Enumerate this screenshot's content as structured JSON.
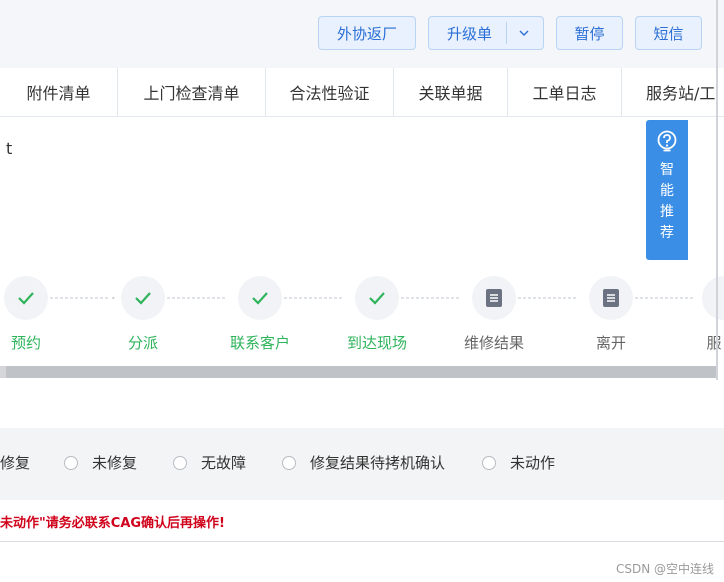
{
  "toolbar": {
    "buttons": [
      "外协返厂",
      "升级单",
      "暂停",
      "短信"
    ]
  },
  "tabs": [
    "附件清单",
    "上门检查清单",
    "合法性验证",
    "关联单据",
    "工单日志",
    "服务站/工"
  ],
  "panel": {
    "truncated_text": "t"
  },
  "smart_recommend": {
    "label": "智能推荐"
  },
  "steps": [
    {
      "label": "预约",
      "status": "done"
    },
    {
      "label": "分派",
      "status": "done"
    },
    {
      "label": "联系客户",
      "status": "done"
    },
    {
      "label": "到达现场",
      "status": "done"
    },
    {
      "label": "维修结果",
      "status": "pending"
    },
    {
      "label": "离开",
      "status": "pending"
    },
    {
      "label": "服",
      "status": "pending"
    }
  ],
  "repair_options": [
    "修复",
    "未修复",
    "无故障",
    "修复结果待拷机确认",
    "未动作"
  ],
  "warning": "未动作\"请务必联系CAG确认后再操作!",
  "watermark": "CSDN @空中连线",
  "colors": {
    "accent": "#2b6fd6",
    "done": "#2fb45c",
    "warning": "#d0021b",
    "smart_bg": "#3a8ee6"
  }
}
